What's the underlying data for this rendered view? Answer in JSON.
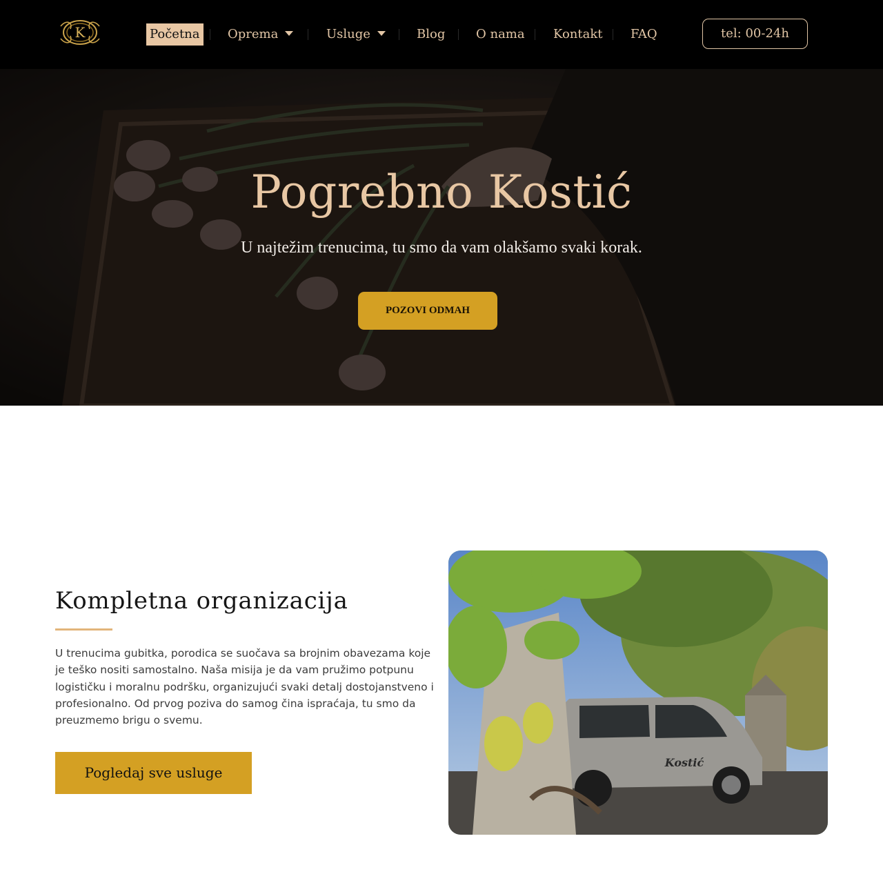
{
  "header": {
    "logo_letter": "K",
    "nav": [
      {
        "label": "Početna",
        "active": true
      },
      {
        "label": "Oprema",
        "dropdown": true
      },
      {
        "label": "Usluge",
        "dropdown": true
      },
      {
        "label": "Blog"
      },
      {
        "label": "O nama"
      },
      {
        "label": "Kontakt"
      },
      {
        "label": "FAQ"
      }
    ],
    "phone_label": "tel: 00-24h"
  },
  "hero": {
    "title": "Pogrebno Kostić",
    "subtitle": "U najtežim trenucima, tu smo da vam olakšamo svaki korak.",
    "cta_label": "POZOVI ODMAH"
  },
  "about": {
    "title": "Kompletna organizacija",
    "text": "U trenucima gubitka, porodica se suočava sa brojnim obavezama koje je teško nositi samostalno. Naša misija je da vam pružimo potpunu logističku i moralnu podršku, organizujući svaki detalj dostojanstveno i profesionalno. Od prvog poziva do samog čina ispraćaja, tu smo da preuzmemo brigu o svemu.",
    "button_label": "Pogledaj sve usluge",
    "photo_van_text": "Kostić"
  },
  "colors": {
    "header_bg": "#000000",
    "accent_gold": "#d4a023",
    "nav_text": "#e2c6a6",
    "hero_title": "#e8c7a4",
    "rule": "#e2b47a"
  }
}
